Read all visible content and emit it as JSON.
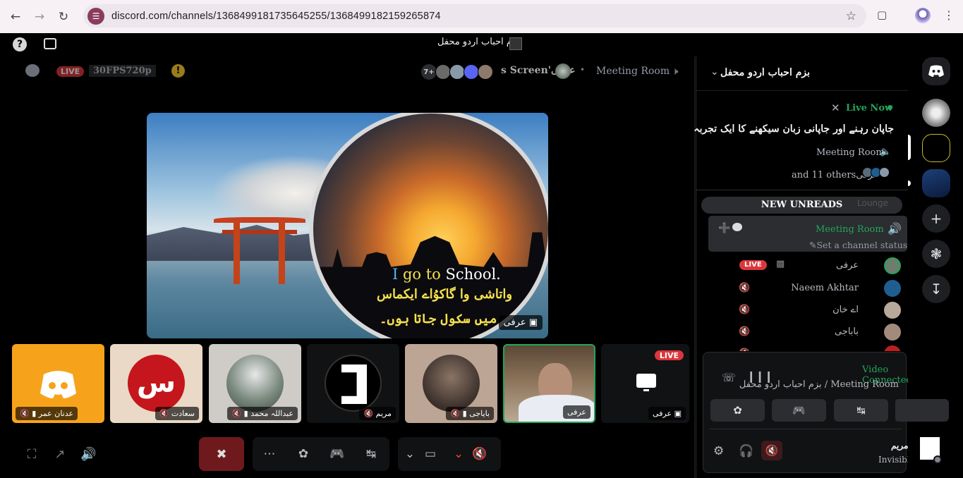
{
  "browser": {
    "url": "discord.com/channels/1368499181735645255/1368499182159265874",
    "icons": [
      "back-icon",
      "forward-icon",
      "reload-icon",
      "site-info-icon",
      "star-icon",
      "extensions-icon",
      "profile-icon",
      "menu-icon"
    ]
  },
  "topbar": {
    "server_title": "بزم احباب اردو محفل"
  },
  "stage": {
    "live_tag": "LIVE",
    "quality": "30FPS720p",
    "viewer_count": "7+",
    "screen_label": "s Screen'عرفی",
    "room": "Meeting Room",
    "main_caption_en_i": "I",
    "main_caption_en_go": " go to",
    "main_caption_en_rest": " School.",
    "main_caption_ur1": "واتاشی وا گاکوُاے ایکماس",
    "main_caption_ur2": "میں سکول جاتا ہوں۔",
    "main_video_name": "عرفی"
  },
  "tiles": [
    {
      "label": "عدنان عمر",
      "color": "#f6a31b"
    },
    {
      "label": "سعادت",
      "color": "#e9d9c6"
    },
    {
      "label": "عبداللہ محمد",
      "color": "#cfcbc6"
    },
    {
      "label": "مریم",
      "color": "#111214"
    },
    {
      "label": "بایاجی",
      "color": "#bca594"
    },
    {
      "label": "عرفی",
      "color": "#6f5a44"
    },
    {
      "label": "عرفی",
      "live": "LIVE",
      "color": "#111214"
    }
  ],
  "sidebar": {
    "server_name": "بزم احباب اردو محفل",
    "live_now": "Live Now",
    "live_topic": "جاپان رہنے اور جاپانی زبان سیکھنے کا ایک تجربہ",
    "live_room": "Meeting Room",
    "live_others": "and 11 others",
    "live_host": "عرفی",
    "new_unreads": "NEW UNREADS",
    "lounge": "Lounge",
    "voice_channel": "Meeting Room",
    "channel_status": "Set a channel status",
    "members": [
      {
        "name": "عرفی",
        "live": "LIVE",
        "color": "#6d7d6e"
      },
      {
        "name": "Naeem Akhtar",
        "color": "#1f5e8f"
      },
      {
        "name": "اے خان",
        "color": "#b9a99a"
      },
      {
        "name": "باباجی",
        "color": "#a38b7c"
      },
      {
        "name": "",
        "color": "#c01d1d"
      }
    ]
  },
  "voice_panel": {
    "status": "Video Connected",
    "room": "Meeting Room",
    "server": "بزم احباب اردو محفل",
    "user_name": "مریم",
    "user_status": "Invisible"
  },
  "colors": {
    "accent_green": "#23a55a",
    "live_red": "#da373c",
    "panel": "#2b2d31"
  }
}
